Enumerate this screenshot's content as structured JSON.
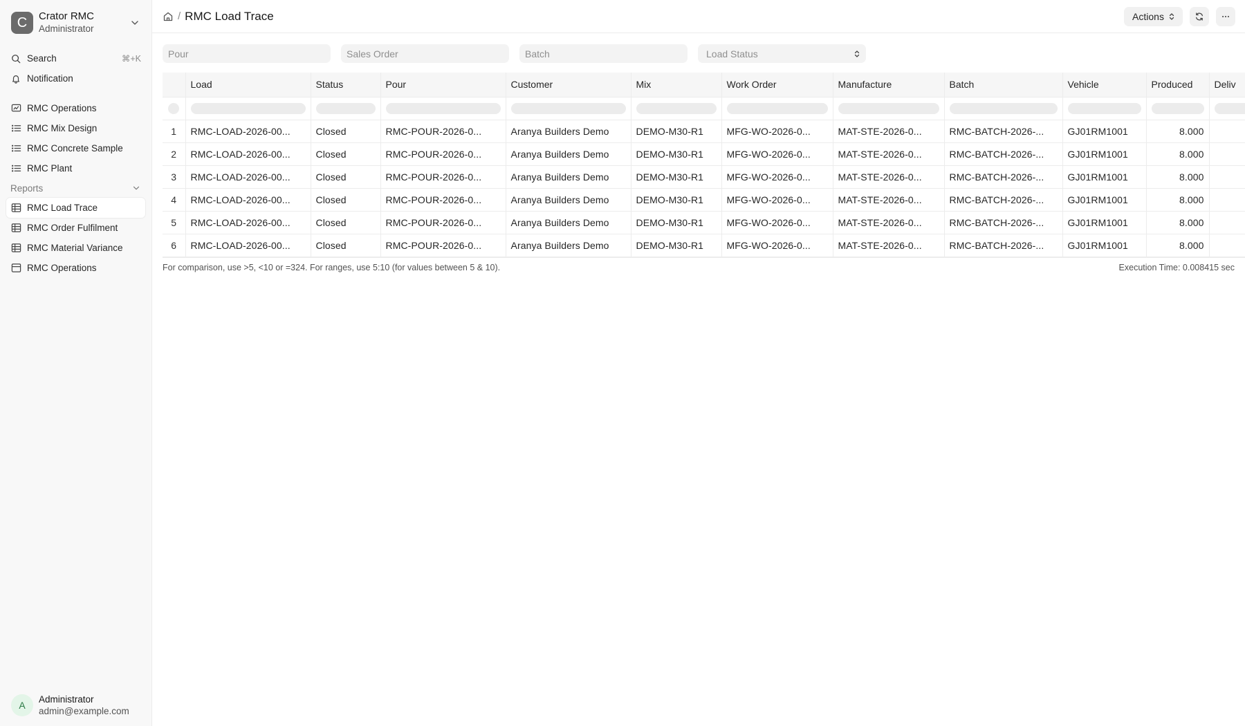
{
  "org": {
    "initial": "C",
    "name": "Crator RMC",
    "role": "Administrator"
  },
  "sidebar": {
    "search_label": "Search",
    "search_shortcut": "⌘+K",
    "notification_label": "Notification",
    "items": [
      {
        "label": "RMC Operations",
        "icon": "dashboard-icon"
      },
      {
        "label": "RMC Mix Design",
        "icon": "list-icon"
      },
      {
        "label": "RMC Concrete Sample",
        "icon": "list-icon"
      },
      {
        "label": "RMC Plant",
        "icon": "list-icon"
      }
    ],
    "reports_label": "Reports",
    "reports": [
      {
        "label": "RMC Load Trace",
        "icon": "table-icon",
        "active": true
      },
      {
        "label": "RMC Order Fulfilment",
        "icon": "table-icon"
      },
      {
        "label": "RMC Material Variance",
        "icon": "table-icon"
      },
      {
        "label": "RMC Operations",
        "icon": "panel-icon"
      }
    ]
  },
  "user": {
    "initial": "A",
    "name": "Administrator",
    "email": "admin@example.com"
  },
  "header": {
    "breadcrumb_sep": "/",
    "title": "RMC Load Trace",
    "actions_label": "Actions"
  },
  "filters": {
    "pour_placeholder": "Pour",
    "sales_order_placeholder": "Sales Order",
    "batch_placeholder": "Batch",
    "load_status_placeholder": "Load Status"
  },
  "table": {
    "columns": [
      "Load",
      "Status",
      "Pour",
      "Customer",
      "Mix",
      "Work Order",
      "Manufacture",
      "Batch",
      "Vehicle",
      "Produced",
      "Deliv"
    ],
    "rows": [
      {
        "n": "1",
        "cells": [
          "RMC-LOAD-2026-00...",
          "Closed",
          "RMC-POUR-2026-0...",
          "Aranya Builders Demo",
          "DEMO-M30-R1",
          "MFG-WO-2026-0...",
          "MAT-STE-2026-0...",
          "RMC-BATCH-2026-...",
          "GJ01RM1001",
          "8.000",
          ""
        ]
      },
      {
        "n": "2",
        "cells": [
          "RMC-LOAD-2026-00...",
          "Closed",
          "RMC-POUR-2026-0...",
          "Aranya Builders Demo",
          "DEMO-M30-R1",
          "MFG-WO-2026-0...",
          "MAT-STE-2026-0...",
          "RMC-BATCH-2026-...",
          "GJ01RM1001",
          "8.000",
          ""
        ]
      },
      {
        "n": "3",
        "cells": [
          "RMC-LOAD-2026-00...",
          "Closed",
          "RMC-POUR-2026-0...",
          "Aranya Builders Demo",
          "DEMO-M30-R1",
          "MFG-WO-2026-0...",
          "MAT-STE-2026-0...",
          "RMC-BATCH-2026-...",
          "GJ01RM1001",
          "8.000",
          ""
        ]
      },
      {
        "n": "4",
        "cells": [
          "RMC-LOAD-2026-00...",
          "Closed",
          "RMC-POUR-2026-0...",
          "Aranya Builders Demo",
          "DEMO-M30-R1",
          "MFG-WO-2026-0...",
          "MAT-STE-2026-0...",
          "RMC-BATCH-2026-...",
          "GJ01RM1001",
          "8.000",
          ""
        ]
      },
      {
        "n": "5",
        "cells": [
          "RMC-LOAD-2026-00...",
          "Closed",
          "RMC-POUR-2026-0...",
          "Aranya Builders Demo",
          "DEMO-M30-R1",
          "MFG-WO-2026-0...",
          "MAT-STE-2026-0...",
          "RMC-BATCH-2026-...",
          "GJ01RM1001",
          "8.000",
          ""
        ]
      },
      {
        "n": "6",
        "cells": [
          "RMC-LOAD-2026-00...",
          "Closed",
          "RMC-POUR-2026-0...",
          "Aranya Builders Demo",
          "DEMO-M30-R1",
          "MFG-WO-2026-0...",
          "MAT-STE-2026-0...",
          "RMC-BATCH-2026-...",
          "GJ01RM1001",
          "8.000",
          ""
        ]
      }
    ]
  },
  "footer": {
    "hint": "For comparison, use >5, <10 or =324. For ranges, use 5:10 (for values between 5 & 10).",
    "execution_time": "Execution Time: 0.008415 sec"
  }
}
